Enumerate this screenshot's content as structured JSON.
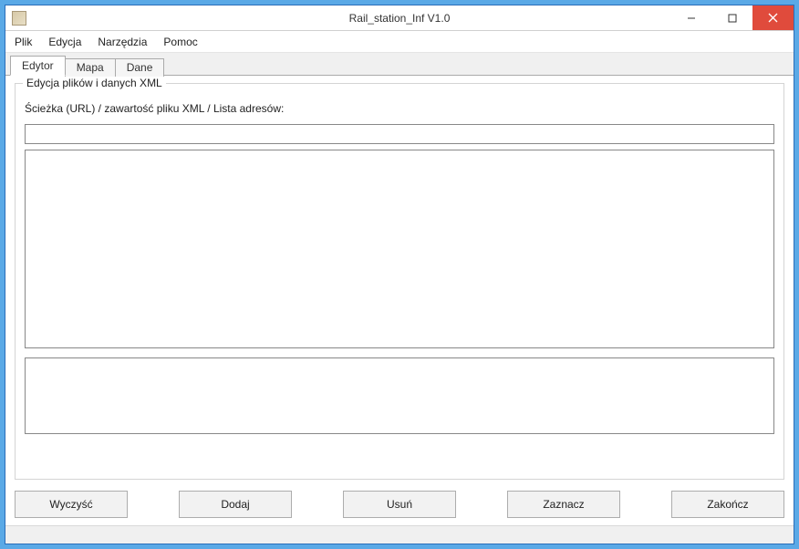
{
  "window": {
    "title": "Rail_station_Inf V1.0"
  },
  "menu": {
    "plik": "Plik",
    "edycja": "Edycja",
    "narzedzia": "Narzędzia",
    "pomoc": "Pomoc"
  },
  "tabs": {
    "edytor": "Edytor",
    "mapa": "Mapa",
    "dane": "Dane"
  },
  "group": {
    "title": "Edycja plików i danych XML",
    "path_label": "Ścieżka (URL) / zawartość pliku XML / Lista adresów:"
  },
  "inputs": {
    "url": "",
    "main_text": "",
    "sub_text": ""
  },
  "buttons": {
    "wyczysc": "Wyczyść",
    "dodaj": "Dodaj",
    "usun": "Usuń",
    "zaznacz": "Zaznacz",
    "zakoncz": "Zakończ"
  }
}
